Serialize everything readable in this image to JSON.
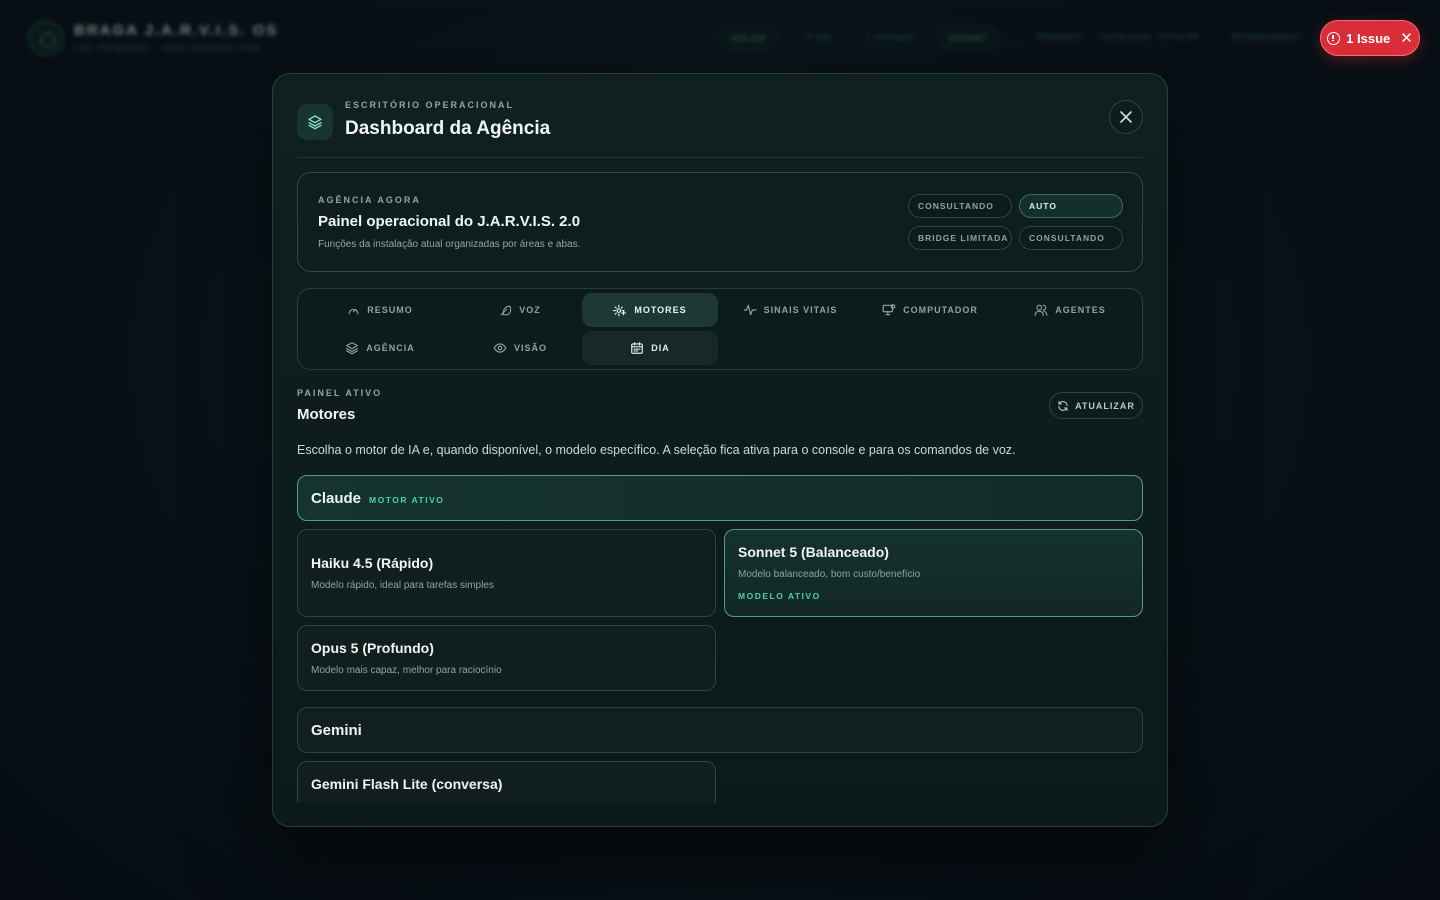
{
  "background_header": {
    "title": "BRAGA J.A.R.V.I.S. OS",
    "subtitle": "VOZ PRIMEIRO · INTELIGÊNCIA VIVA",
    "pills": [
      "ONLINE",
      "SONNET"
    ],
    "texts": [
      "0 real",
      "1 atividade",
      "PASSADO",
      "TU/05/2026 · 09:09:09",
      "DESENHANDO"
    ]
  },
  "issue_badge": {
    "label": "1 Issue",
    "color": "#d92d3a"
  },
  "modal": {
    "eyebrow": "ESCRITÓRIO OPERACIONAL",
    "title": "Dashboard da Agência",
    "agency_card": {
      "eyebrow": "AGÊNCIA AGORA",
      "title": "Painel operacional do J.A.R.V.I.S. 2.0",
      "description": "Funções da instalação atual organizadas por áreas e abas.",
      "status_pills": [
        {
          "label": "CONSULTANDO",
          "active": false
        },
        {
          "label": "AUTO",
          "active": true
        },
        {
          "label": "BRIDGE LIMITADA",
          "active": false
        },
        {
          "label": "CONSULTANDO",
          "active": false
        }
      ]
    },
    "tabs": [
      {
        "label": "RESUMO",
        "icon": "gauge-icon"
      },
      {
        "label": "VOZ",
        "icon": "feather-icon"
      },
      {
        "label": "MOTORES",
        "icon": "engine-icon",
        "selected": true
      },
      {
        "label": "SINAIS VITAIS",
        "icon": "pulse-icon"
      },
      {
        "label": "COMPUTADOR",
        "icon": "monitor-icon"
      },
      {
        "label": "AGENTES",
        "icon": "users-icon"
      },
      {
        "label": "AGÊNCIA",
        "icon": "layers-icon"
      },
      {
        "label": "VISÃO",
        "icon": "eye-icon"
      },
      {
        "label": "DIA",
        "icon": "calendar-icon",
        "hover": true
      }
    ],
    "panel": {
      "eyebrow": "PAINEL ATIVO",
      "title": "Motores",
      "refresh_label": "ATUALIZAR",
      "description": "Escolha o motor de IA e, quando disponível, o modelo específico. A seleção fica ativa para o console e para os comandos de voz."
    },
    "engines": [
      {
        "name": "Claude",
        "badge": "MOTOR ATIVO",
        "active": true,
        "models": [
          {
            "name": "Haiku 4.5 (Rápido)",
            "description": "Modelo rápido, ideal para tarefas simples",
            "active": false
          },
          {
            "name": "Sonnet 5 (Balanceado)",
            "description": "Modelo balanceado, bom custo/benefício",
            "badge": "MODELO ATIVO",
            "active": true
          },
          {
            "name": "Opus 5 (Profundo)",
            "description": "Modelo mais capaz, melhor para raciocínio",
            "active": false
          }
        ]
      },
      {
        "name": "Gemini",
        "active": false,
        "models": [
          {
            "name": "Gemini Flash Lite (conversa)",
            "description": "",
            "active": false
          }
        ]
      }
    ],
    "accent_color": "#4fd0a4"
  }
}
